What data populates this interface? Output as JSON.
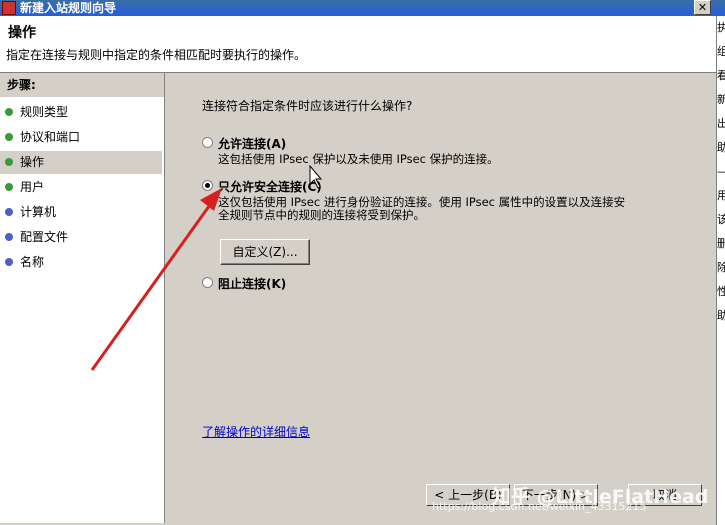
{
  "window": {
    "title": "新建入站规则向导",
    "close_label": "✕"
  },
  "header": {
    "title": "操作",
    "subtitle": "指定在连接与规则中指定的条件相匹配时要执行的操作。"
  },
  "sidebar": {
    "title": "步骤:",
    "items": [
      {
        "label": "规则类型",
        "color": "#3a9a3a"
      },
      {
        "label": "协议和端口",
        "color": "#3a9a3a"
      },
      {
        "label": "操作",
        "color": "#3a9a3a"
      },
      {
        "label": "用户",
        "color": "#3a9a3a"
      },
      {
        "label": "计算机",
        "color": "#4a5fc9"
      },
      {
        "label": "配置文件",
        "color": "#4a5fc9"
      },
      {
        "label": "名称",
        "color": "#4a5fc9"
      }
    ]
  },
  "main": {
    "question": "连接符合指定条件时应该进行什么操作?",
    "options": [
      {
        "label": "允许连接(A)",
        "desc1": "这包括使用 IPsec 保护以及未使用 IPsec 保护的连接。",
        "desc2": ""
      },
      {
        "label": "只允许安全连接(C)",
        "desc1": "这仅包括使用 IPsec 进行身份验证的连接。使用 IPsec 属性中的设置以及连接安",
        "desc2": "全规则节点中的规则的连接将受到保护。"
      },
      {
        "label": "阻止连接(K)",
        "desc1": "",
        "desc2": ""
      }
    ],
    "customize_label": "自定义(Z)...",
    "learn_more": "了解操作的详细信息",
    "back_label": "< 上一步(B)",
    "next_label": "下一步(N) >",
    "cancel_label": "取消"
  },
  "right_strip": [
    "执",
    "组",
    "看",
    "新",
    "出",
    "助",
    "—",
    "用",
    "该",
    "删",
    "除",
    "性",
    "助"
  ],
  "watermark": {
    "brand": "知乎 @LittleFlatHead",
    "url": "https://blog.csdn.net/weixin_43315215"
  },
  "colors": {
    "accent": "#245edb",
    "arrow": "#d62020",
    "link": "#0000cc"
  }
}
